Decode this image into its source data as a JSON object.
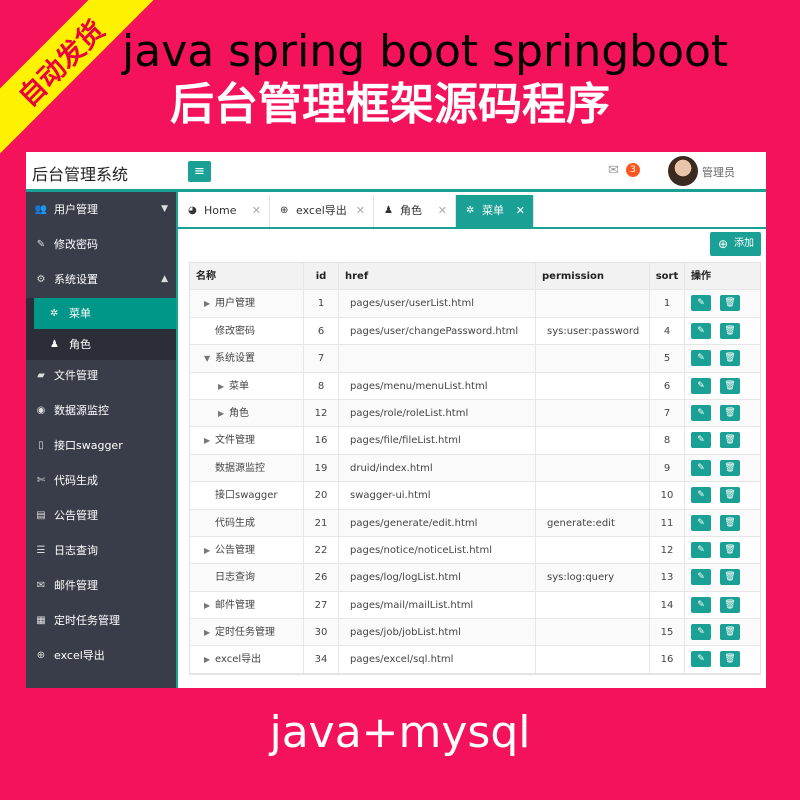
{
  "promo": {
    "ribbon": "自动发货",
    "line1": "java spring boot springboot",
    "line2": "后台管理框架源码程序",
    "line3": "java+mysql"
  },
  "header": {
    "title": "后台管理系统",
    "menu_icon": "hamburger-icon",
    "mail_count": "3",
    "username": "管理员"
  },
  "sidebar": {
    "items": [
      {
        "label": "用户管理",
        "icon": "users-icon",
        "arrow": "▼"
      },
      {
        "label": "修改密码",
        "icon": "edit-icon"
      },
      {
        "label": "系统设置",
        "icon": "cogs-icon",
        "arrow": "▲"
      },
      {
        "label": "文件管理",
        "icon": "folder-icon"
      },
      {
        "label": "数据源监控",
        "icon": "eye-icon"
      },
      {
        "label": "接口swagger",
        "icon": "file-icon"
      },
      {
        "label": "代码生成",
        "icon": "wrench-icon"
      },
      {
        "label": "公告管理",
        "icon": "book-icon"
      },
      {
        "label": "日志查询",
        "icon": "list-icon"
      },
      {
        "label": "邮件管理",
        "icon": "envelope-icon"
      },
      {
        "label": "定时任务管理",
        "icon": "tasks-icon"
      },
      {
        "label": "excel导出",
        "icon": "download-icon"
      }
    ],
    "subitems": [
      {
        "label": "菜单",
        "icon": "gear-icon"
      },
      {
        "label": "角色",
        "icon": "user-icon"
      }
    ]
  },
  "tabs": [
    {
      "label": "Home",
      "icon": "dashboard-icon"
    },
    {
      "label": "excel导出",
      "icon": "download-icon"
    },
    {
      "label": "角色",
      "icon": "user-icon"
    },
    {
      "label": "菜单",
      "icon": "gear-icon"
    }
  ],
  "toolbar": {
    "add_label": "添加"
  },
  "table": {
    "headers": [
      "名称",
      "id",
      "href",
      "permission",
      "sort",
      "操作"
    ],
    "rows": [
      {
        "name": "用户管理",
        "indent": 1,
        "arrow": "▶",
        "id": "1",
        "href": "pages/user/userList.html",
        "permission": "",
        "sort": "1"
      },
      {
        "name": "修改密码",
        "indent": 1,
        "arrow": "",
        "id": "6",
        "href": "pages/user/changePassword.html",
        "permission": "sys:user:password",
        "sort": "4"
      },
      {
        "name": "系统设置",
        "indent": 1,
        "arrow": "▼",
        "id": "7",
        "href": "",
        "permission": "",
        "sort": "5"
      },
      {
        "name": "菜单",
        "indent": 2,
        "arrow": "▶",
        "id": "8",
        "href": "pages/menu/menuList.html",
        "permission": "",
        "sort": "6"
      },
      {
        "name": "角色",
        "indent": 2,
        "arrow": "▶",
        "id": "12",
        "href": "pages/role/roleList.html",
        "permission": "",
        "sort": "7"
      },
      {
        "name": "文件管理",
        "indent": 1,
        "arrow": "▶",
        "id": "16",
        "href": "pages/file/fileList.html",
        "permission": "",
        "sort": "8"
      },
      {
        "name": "数据源监控",
        "indent": 1,
        "arrow": "",
        "id": "19",
        "href": "druid/index.html",
        "permission": "",
        "sort": "9"
      },
      {
        "name": "接口swagger",
        "indent": 1,
        "arrow": "",
        "id": "20",
        "href": "swagger-ui.html",
        "permission": "",
        "sort": "10"
      },
      {
        "name": "代码生成",
        "indent": 1,
        "arrow": "",
        "id": "21",
        "href": "pages/generate/edit.html",
        "permission": "generate:edit",
        "sort": "11"
      },
      {
        "name": "公告管理",
        "indent": 1,
        "arrow": "▶",
        "id": "22",
        "href": "pages/notice/noticeList.html",
        "permission": "",
        "sort": "12"
      },
      {
        "name": "日志查询",
        "indent": 1,
        "arrow": "",
        "id": "26",
        "href": "pages/log/logList.html",
        "permission": "sys:log:query",
        "sort": "13"
      },
      {
        "name": "邮件管理",
        "indent": 1,
        "arrow": "▶",
        "id": "27",
        "href": "pages/mail/mailList.html",
        "permission": "",
        "sort": "14"
      },
      {
        "name": "定时任务管理",
        "indent": 1,
        "arrow": "▶",
        "id": "30",
        "href": "pages/job/jobList.html",
        "permission": "",
        "sort": "15"
      },
      {
        "name": "excel导出",
        "indent": 1,
        "arrow": "▶",
        "id": "34",
        "href": "pages/excel/sql.html",
        "permission": "",
        "sort": "16"
      }
    ]
  },
  "colors": {
    "accent": "#1aa094",
    "sidebar": "#393d49",
    "background": "#f4135a",
    "ribbon": "#fff200"
  }
}
